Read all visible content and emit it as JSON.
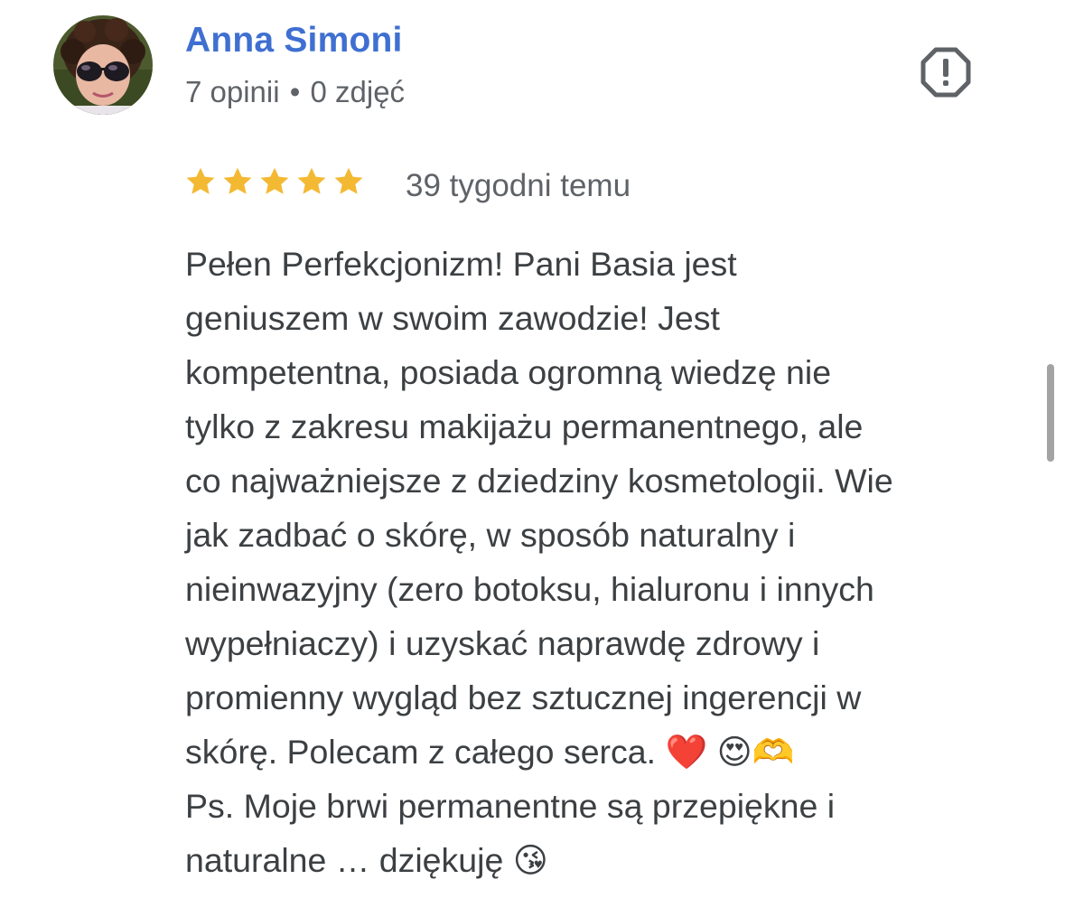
{
  "reviewer": {
    "name": "Anna Simoni",
    "review_count": "7 opinii",
    "separator": "•",
    "photo_count": "0 zdjęć",
    "avatar_icon": "user-avatar-photo"
  },
  "report": {
    "icon": "report-flag-octagon-icon"
  },
  "review": {
    "rating": 5,
    "rating_max": 5,
    "date": "39 tygodni temu",
    "text": "Pełen Perfekcjonizm! Pani Basia jest\ngeniuszem w swoim zawodzie! Jest\nkompetentna, posiada ogromną wiedzę nie\ntylko z zakresu makijażu permanentnego, ale\nco najważniejsze z dziedziny kosmetologii. Wie\njak zadbać o skórę, w sposób naturalny i\nnieinwazyjny (zero botoksu, hialuronu i innych\nwypełniaczy) i uzyskać naprawdę zdrowy i\npromienny wygląd bez sztucznej ingerencji w\nskórę. Polecam z całego serca. ❤️ 😍🫶\nPs. Moje brwi permanentne są przepiękne i\nnaturalne … dziękuję 😘"
  },
  "colors": {
    "name": "#3f6fd1",
    "star": "#f4b933",
    "text": "#3c4043",
    "meta": "#5f6368"
  }
}
